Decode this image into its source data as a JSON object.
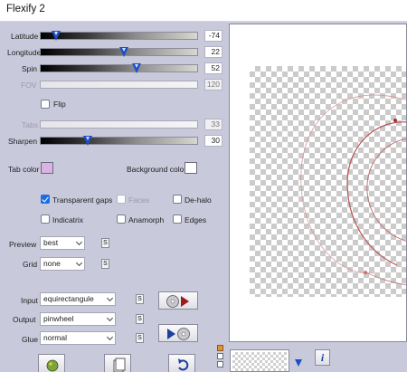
{
  "window": {
    "title": "Flexify 2"
  },
  "sliders": [
    {
      "label": "Latitude",
      "value": "-74",
      "enabled": true,
      "level": 0.1
    },
    {
      "label": "Longitude",
      "value": "22",
      "enabled": true,
      "level": 0.53
    },
    {
      "label": "Spin",
      "value": "52",
      "enabled": true,
      "level": 0.61
    },
    {
      "label": "FOV",
      "value": "120",
      "enabled": false
    },
    {
      "label": "Tabs",
      "value": "33",
      "enabled": false
    },
    {
      "label": "Sharpen",
      "value": "30",
      "enabled": true,
      "level": 0.3
    }
  ],
  "flip": {
    "label": "Flip",
    "checked": false
  },
  "colors": {
    "tab_label": "Tab color",
    "tab_color": "#d9b4e2",
    "background_label": "Background color",
    "background_color": "#ffffff"
  },
  "options": {
    "transparent_gaps": {
      "label": "Transparent gaps",
      "checked": true
    },
    "faces": {
      "label": "Faces",
      "checked": false,
      "enabled": false
    },
    "de_halo": {
      "label": "De-halo",
      "checked": false
    },
    "indicatrix": {
      "label": "Indicatrix",
      "checked": false
    },
    "anamorph": {
      "label": "Anamorph",
      "checked": false
    },
    "edges": {
      "label": "Edges",
      "checked": false
    }
  },
  "preview_quality": {
    "label": "Preview",
    "value": "best"
  },
  "grid": {
    "label": "Grid",
    "value": "none"
  },
  "projection": {
    "input_label": "Input",
    "input_value": "equirectangule",
    "output_label": "Output",
    "output_value": "pinwheel",
    "glue_label": "Glue",
    "glue_value": "normal"
  },
  "s_button": "S",
  "info_button": "i",
  "accent": "#1d4fc4"
}
